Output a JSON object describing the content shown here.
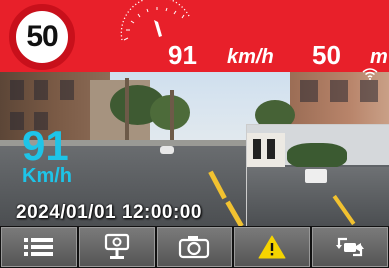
{
  "speed_limit": {
    "value": "50"
  },
  "current_speed": {
    "value": "91",
    "unit": "km/h"
  },
  "distance": {
    "value": "50",
    "unit": "m"
  },
  "overlay_speed": {
    "value": "91",
    "unit": "Km/h"
  },
  "timestamp": "2024/01/01  12:00:00",
  "toolbar": {
    "buttons": [
      {
        "icon": "menu-icon"
      },
      {
        "icon": "speed-camera-icon"
      },
      {
        "icon": "camera-icon"
      },
      {
        "icon": "warning-icon",
        "accent": "#f5d400"
      },
      {
        "icon": "switch-camera-icon"
      }
    ]
  },
  "colors": {
    "topbar": "#e8202a",
    "overlay_speed": "#1ec4e8"
  }
}
